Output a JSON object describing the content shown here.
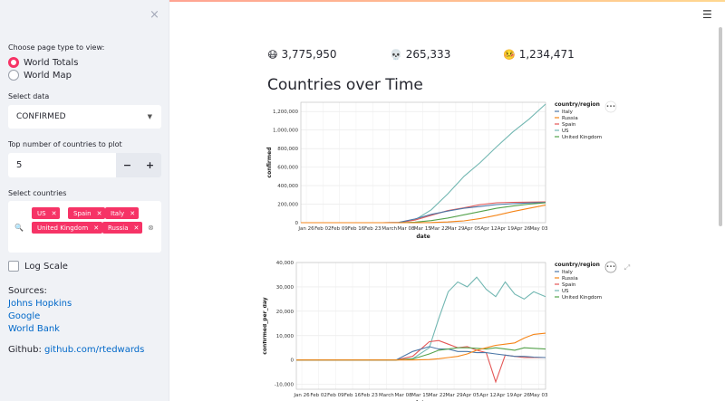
{
  "sidebar": {
    "close_icon": "×",
    "page_type_label": "Choose page type to view:",
    "page_types": [
      {
        "label": "World Totals",
        "selected": true
      },
      {
        "label": "World Map",
        "selected": false
      }
    ],
    "data_label": "Select data",
    "data_value": "CONFIRMED",
    "top_n_label": "Top number of countries to plot",
    "top_n_value": "5",
    "minus": "−",
    "plus": "+",
    "countries_label": "Select countries",
    "countries": [
      "US",
      "Spain",
      "Italy",
      "United Kingdom",
      "Russia"
    ],
    "log_scale_label": "Log Scale",
    "sources_title": "Sources:",
    "sources": [
      "Johns Hopkins",
      "Google",
      "World Bank"
    ],
    "github_prefix": "Github:",
    "github_link": "github.com/rtedwards"
  },
  "main": {
    "hamburger_icon": "☰",
    "stats": [
      {
        "icon": "😷",
        "value": "3,775,950"
      },
      {
        "icon": "💀",
        "value": "265,333"
      },
      {
        "icon": "🤒",
        "value": "1,234,471"
      }
    ],
    "heading": "Countries over Time"
  },
  "colors": {
    "Italy": "#4c78a8",
    "Russia": "#f58518",
    "Spain": "#e45756",
    "US": "#72b7b2",
    "United Kingdom": "#54a24b",
    "accent": "#f63366"
  },
  "chart_data": [
    {
      "type": "line",
      "xlabel": "date",
      "ylabel": "confirmed",
      "legend_title": "country/region",
      "legend": [
        "Italy",
        "Russia",
        "Spain",
        "US",
        "United Kingdom"
      ],
      "x_ticks": [
        "Jan 26",
        "Feb 02",
        "Feb 09",
        "Feb 16",
        "Feb 23",
        "March",
        "Mar 08",
        "Mar 15",
        "Mar 22",
        "Mar 29",
        "Apr 05",
        "Apr 12",
        "Apr 19",
        "Apr 26",
        "May 03"
      ],
      "y_ticks": [
        "0",
        "200,000",
        "400,000",
        "600,000",
        "800,000",
        "1,000,000",
        "1,200,000"
      ],
      "ylim": [
        0,
        1300000
      ],
      "x_days": [
        0,
        35,
        42,
        49,
        56,
        63,
        70,
        77,
        84,
        91,
        98,
        105
      ],
      "series": [
        {
          "name": "US",
          "values": [
            0,
            0,
            500,
            30000,
            140000,
            310000,
            500000,
            650000,
            820000,
            980000,
            1120000,
            1280000
          ]
        },
        {
          "name": "Spain",
          "values": [
            0,
            0,
            1500,
            28000,
            80000,
            130000,
            160000,
            195000,
            215000,
            220000,
            222000,
            225000
          ]
        },
        {
          "name": "Italy",
          "values": [
            0,
            0,
            3000,
            40000,
            90000,
            125000,
            155000,
            175000,
            195000,
            205000,
            213000,
            218000
          ]
        },
        {
          "name": "United Kingdom",
          "values": [
            0,
            0,
            300,
            6000,
            22000,
            50000,
            85000,
            120000,
            155000,
            180000,
            200000,
            215000
          ]
        },
        {
          "name": "Russia",
          "values": [
            0,
            0,
            0,
            300,
            2000,
            8000,
            20000,
            45000,
            80000,
            120000,
            155000,
            190000
          ]
        }
      ]
    },
    {
      "type": "line",
      "xlabel": "date",
      "ylabel": "confirmed_per_day",
      "legend_title": "country/region",
      "legend": [
        "Italy",
        "Russia",
        "Spain",
        "US",
        "United Kingdom"
      ],
      "x_ticks": [
        "Jan 26",
        "Feb 02",
        "Feb 09",
        "Feb 16",
        "Feb 23",
        "March",
        "Mar 08",
        "Mar 15",
        "Mar 22",
        "Mar 29",
        "Apr 05",
        "Apr 12",
        "Apr 19",
        "Apr 26",
        "May 03"
      ],
      "y_ticks": [
        "-10,000",
        "0",
        "10,000",
        "20,000",
        "30,000",
        "40,000"
      ],
      "ylim": [
        -12000,
        40000
      ],
      "x_days": [
        0,
        42,
        49,
        56,
        60,
        64,
        68,
        72,
        76,
        80,
        84,
        88,
        92,
        96,
        100,
        105
      ],
      "series": [
        {
          "name": "US",
          "values": [
            0,
            0,
            500,
            5000,
            17000,
            28000,
            32000,
            30000,
            34000,
            29000,
            26000,
            32000,
            27000,
            25000,
            28000,
            26000
          ]
        },
        {
          "name": "Spain",
          "values": [
            0,
            0,
            1500,
            7500,
            8000,
            6500,
            5000,
            5500,
            4000,
            3000,
            -9000,
            2000,
            1500,
            1000,
            1000,
            1000
          ]
        },
        {
          "name": "Italy",
          "values": [
            0,
            0,
            3500,
            5500,
            4500,
            4500,
            3500,
            3500,
            3000,
            3000,
            2500,
            2000,
            1500,
            1500,
            1200,
            1000
          ]
        },
        {
          "name": "United Kingdom",
          "values": [
            0,
            0,
            400,
            2500,
            4000,
            4500,
            5000,
            5000,
            4800,
            4500,
            5000,
            4500,
            4000,
            5000,
            4800,
            4500
          ]
        },
        {
          "name": "Russia",
          "values": [
            0,
            0,
            0,
            200,
            500,
            1000,
            1500,
            2500,
            4000,
            5000,
            6000,
            6500,
            7000,
            9000,
            10500,
            11000
          ]
        }
      ]
    }
  ]
}
